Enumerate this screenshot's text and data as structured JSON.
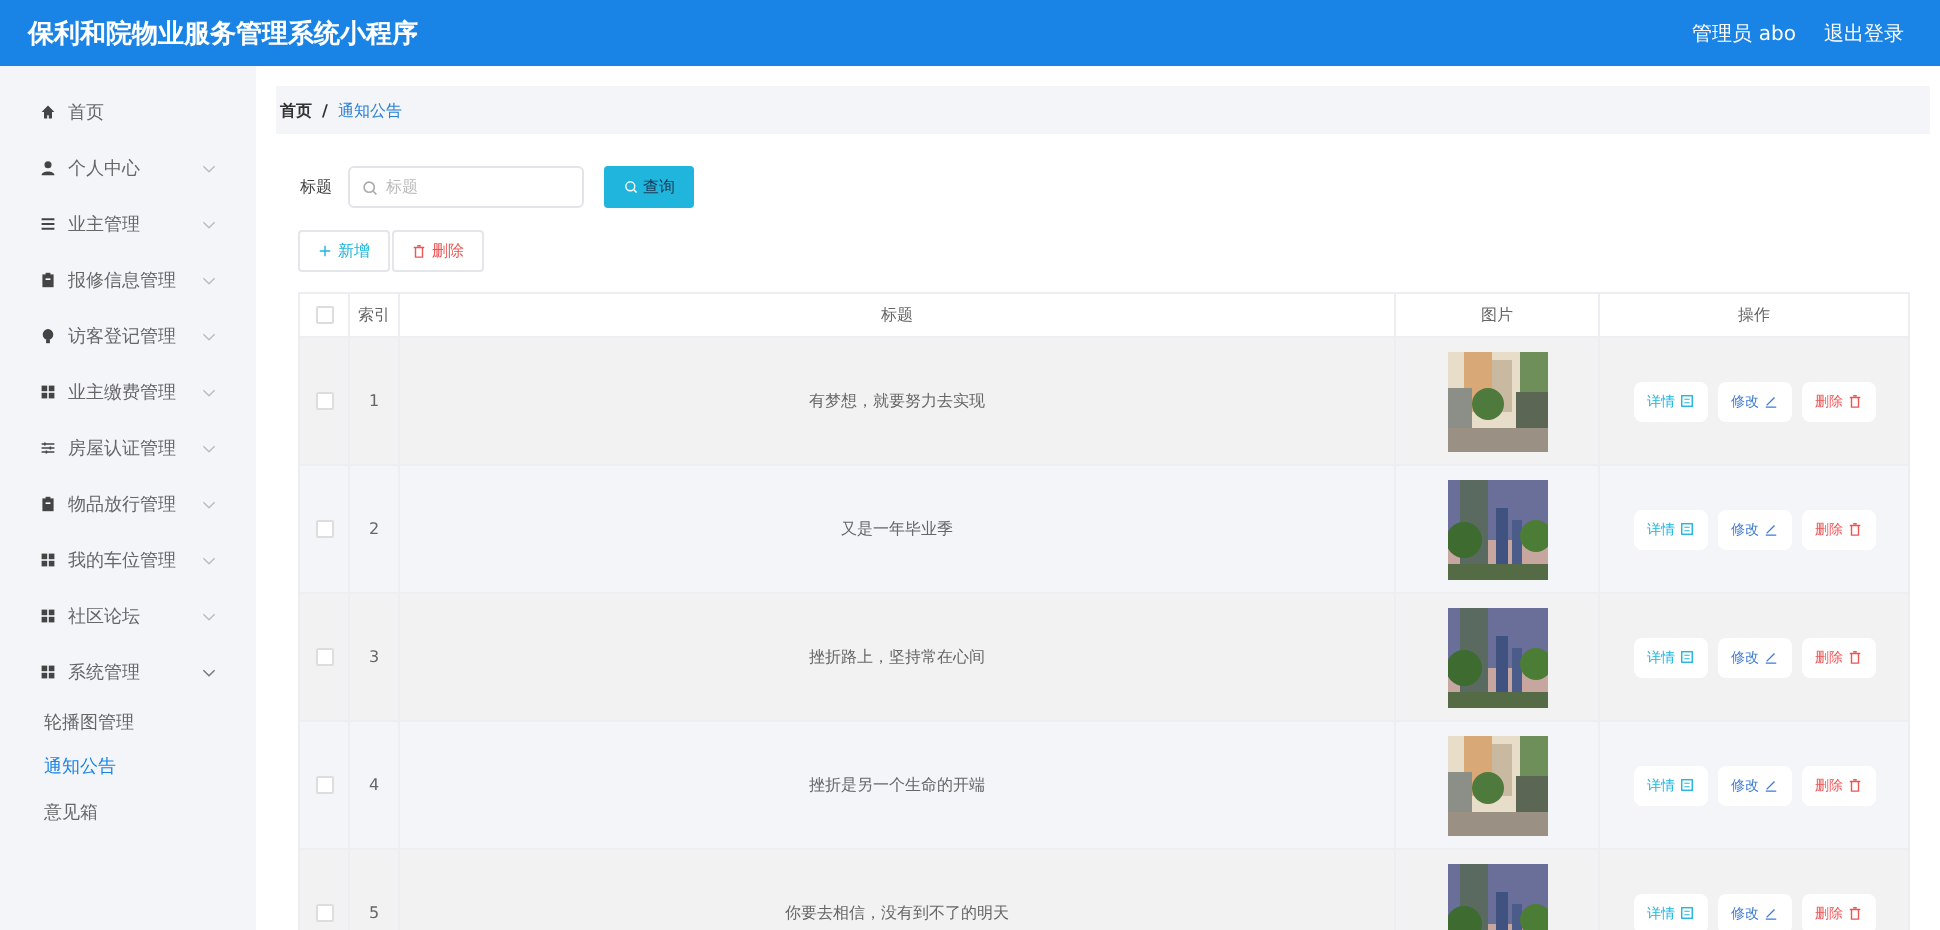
{
  "header": {
    "title": "保利和院物业服务管理系统小程序",
    "user": "管理员 abo",
    "logout": "退出登录"
  },
  "sidebar": {
    "items": [
      {
        "label": "首页",
        "kind": "home"
      },
      {
        "label": "个人中心",
        "kind": "user",
        "expanded": false
      },
      {
        "label": "业主管理",
        "kind": "list",
        "expanded": false
      },
      {
        "label": "报修信息管理",
        "kind": "clipboard",
        "expanded": false
      },
      {
        "label": "访客登记管理",
        "kind": "bulb",
        "expanded": false
      },
      {
        "label": "业主缴费管理",
        "kind": "grid",
        "expanded": false
      },
      {
        "label": "房屋认证管理",
        "kind": "sliders",
        "expanded": false
      },
      {
        "label": "物品放行管理",
        "kind": "clipboard",
        "expanded": false
      },
      {
        "label": "我的车位管理",
        "kind": "grid",
        "expanded": false
      },
      {
        "label": "社区论坛",
        "kind": "grid",
        "expanded": false
      },
      {
        "label": "系统管理",
        "kind": "grid",
        "expanded": true,
        "children": [
          {
            "label": "轮播图管理",
            "selected": false
          },
          {
            "label": "通知公告",
            "selected": true
          },
          {
            "label": "意见箱",
            "selected": false
          }
        ]
      }
    ]
  },
  "breadcrumb": {
    "separator": "/",
    "items": [
      "首页",
      "通知公告"
    ]
  },
  "search": {
    "label": "标题",
    "placeholder": "标题",
    "button": "查询"
  },
  "toolbar": [
    {
      "label": "新增",
      "kind": "add"
    },
    {
      "label": "删除",
      "kind": "delete"
    }
  ],
  "table": {
    "select_all": {
      "checked": false
    },
    "columns": [
      "索引",
      "标题",
      "图片",
      "操作"
    ],
    "rows": [
      {
        "index": "1",
        "title": "有梦想，就要努力去实现",
        "checked": false,
        "picture": {
          "kind": "picture"
        },
        "actions": [
          {
            "label": "详情",
            "kind": "detail"
          },
          {
            "label": "修改",
            "kind": "edit"
          },
          {
            "label": "删除",
            "kind": "delete"
          }
        ]
      },
      {
        "index": "2",
        "title": "又是一年毕业季",
        "checked": false,
        "picture": {
          "kind": "picture"
        },
        "actions": [
          {
            "label": "详情",
            "kind": "detail"
          },
          {
            "label": "修改",
            "kind": "edit"
          },
          {
            "label": "删除",
            "kind": "delete"
          }
        ]
      },
      {
        "index": "3",
        "title": "挫折路上，坚持常在心间",
        "checked": false,
        "picture": {
          "kind": "picture"
        },
        "actions": [
          {
            "label": "详情",
            "kind": "detail"
          },
          {
            "label": "修改",
            "kind": "edit"
          },
          {
            "label": "删除",
            "kind": "delete"
          }
        ]
      },
      {
        "index": "4",
        "title": "挫折是另一个生命的开端",
        "checked": false,
        "picture": {
          "kind": "picture"
        },
        "actions": [
          {
            "label": "详情",
            "kind": "detail"
          },
          {
            "label": "修改",
            "kind": "edit"
          },
          {
            "label": "删除",
            "kind": "delete"
          }
        ]
      },
      {
        "index": "5",
        "title": "你要去相信，没有到不了的明天",
        "checked": false,
        "picture": {
          "kind": "picture"
        },
        "actions": [
          {
            "label": "详情",
            "kind": "detail"
          },
          {
            "label": "修改",
            "kind": "edit"
          },
          {
            "label": "删除",
            "kind": "delete"
          }
        ]
      }
    ]
  }
}
